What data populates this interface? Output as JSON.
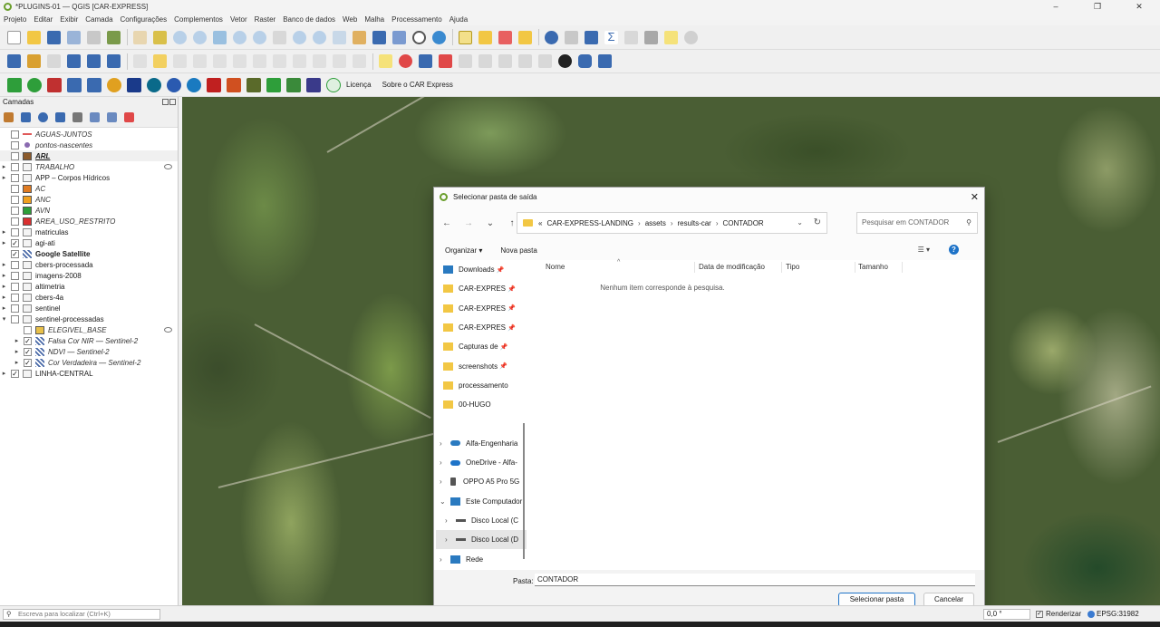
{
  "window": {
    "title": "*PLUGINS-01 — QGIS [CAR-EXPRESS]",
    "controls": [
      "–",
      "❐",
      "✕"
    ]
  },
  "menu": [
    "Projeto",
    "Editar",
    "Exibir",
    "Camada",
    "Configurações",
    "Complementos",
    "Vetor",
    "Raster",
    "Banco de dados",
    "Web",
    "Malha",
    "Processamento",
    "Ajuda"
  ],
  "plugin_toolbar": {
    "licenca_label": "Licença",
    "sobre_label": "Sobre o CAR Express"
  },
  "layers_panel": {
    "title": "Camadas",
    "layers": [
      {
        "label": "AGUAS-JUNTOS",
        "style": "it",
        "checked": false,
        "expander": "",
        "symbol_color": "#e05a5a",
        "symbol": "line"
      },
      {
        "label": "pontos-nascentes",
        "style": "it",
        "checked": false,
        "expander": "",
        "symbol_color": "#8a6ab0",
        "symbol": "dot"
      },
      {
        "label": "ARL",
        "style": "u",
        "checked": false,
        "expander": "",
        "symbol_color": "#8b5a2b",
        "symbol": "fill",
        "selected": true
      },
      {
        "label": "TRABALHO",
        "style": "it",
        "checked": false,
        "expander": "▸",
        "symbol_color": "#888888",
        "symbol": "group",
        "eye": true
      },
      {
        "label": "APP – Corpos Hídricos",
        "style": "",
        "checked": false,
        "expander": "▸",
        "symbol_color": "#888888",
        "symbol": "group"
      },
      {
        "label": "AC",
        "style": "it",
        "checked": false,
        "expander": "",
        "symbol_color": "#e07b22",
        "symbol": "fill"
      },
      {
        "label": "ANC",
        "style": "it",
        "checked": false,
        "expander": "",
        "symbol_color": "#f0a020",
        "symbol": "fill"
      },
      {
        "label": "AVN",
        "style": "it",
        "checked": false,
        "expander": "",
        "symbol_color": "#2e9e3a",
        "symbol": "fill"
      },
      {
        "label": "AREA_USO_RESTRITO",
        "style": "it",
        "checked": false,
        "expander": "",
        "symbol_color": "#d93030",
        "symbol": "fill"
      },
      {
        "label": "matriculas",
        "style": "",
        "checked": false,
        "expander": "▸",
        "symbol_color": "#888888",
        "symbol": "group"
      },
      {
        "label": "agi-ati",
        "style": "",
        "checked": true,
        "expander": "▸",
        "symbol_color": "#888888",
        "symbol": "group"
      },
      {
        "label": "Google Satellite",
        "style": "b",
        "checked": true,
        "expander": "",
        "symbol_color": "#4a6aa8",
        "symbol": "raster"
      },
      {
        "label": "cbers-processada",
        "style": "",
        "checked": false,
        "expander": "▸",
        "symbol_color": "#888888",
        "symbol": "group"
      },
      {
        "label": "imagens-2008",
        "style": "",
        "checked": false,
        "expander": "▸",
        "symbol_color": "#888888",
        "symbol": "group"
      },
      {
        "label": "altimetria",
        "style": "",
        "checked": false,
        "expander": "▸",
        "symbol_color": "#888888",
        "symbol": "group"
      },
      {
        "label": "cbers-4a",
        "style": "",
        "checked": false,
        "expander": "▸",
        "symbol_color": "#888888",
        "symbol": "group"
      },
      {
        "label": "sentinel",
        "style": "",
        "checked": false,
        "expander": "▸",
        "symbol_color": "#888888",
        "symbol": "group"
      },
      {
        "label": "sentinel-processadas",
        "style": "",
        "checked": false,
        "expander": "▾",
        "symbol_color": "#888888",
        "symbol": "group"
      },
      {
        "label": "ELEGIVEL_BASE",
        "style": "it",
        "checked": false,
        "expander": "",
        "symbol_color": "#e8c04a",
        "symbol": "fill",
        "indent": true,
        "eye": true
      },
      {
        "label": "Falsa Cor NIR — Sentinel-2",
        "style": "it",
        "checked": true,
        "expander": "▸",
        "symbol_color": "#4a6aa8",
        "symbol": "raster",
        "indent": true
      },
      {
        "label": "NDVI — Sentinel-2",
        "style": "it",
        "checked": true,
        "expander": "▸",
        "symbol_color": "#4a6aa8",
        "symbol": "raster",
        "indent": true
      },
      {
        "label": "Cor Verdadeira — Sentinel-2",
        "style": "it",
        "checked": true,
        "expander": "▸",
        "symbol_color": "#4a6aa8",
        "symbol": "raster",
        "indent": true
      },
      {
        "label": "LINHA-CENTRAL",
        "style": "",
        "checked": true,
        "expander": "▸",
        "symbol_color": "#888888",
        "symbol": "group"
      }
    ]
  },
  "dialog": {
    "title": "Selecionar pasta de saída",
    "breadcrumb": [
      "«",
      "CAR-EXPRESS-LANDING",
      "assets",
      "results-car",
      "CONTADOR"
    ],
    "search_placeholder": "Pesquisar em CONTADOR",
    "organize_label": "Organizar ▾",
    "new_folder_label": "Nova pasta",
    "columns": [
      "Nome",
      "Data de modificação",
      "Tipo",
      "Tamanho"
    ],
    "empty_message": "Nenhum item corresponde à pesquisa.",
    "nav_items": [
      {
        "label": "Downloads",
        "icon": "download",
        "pin": true,
        "chev": ""
      },
      {
        "label": "CAR-EXPRES",
        "icon": "folder",
        "pin": true,
        "chev": ""
      },
      {
        "label": "CAR-EXPRES",
        "icon": "folder",
        "pin": true,
        "chev": ""
      },
      {
        "label": "CAR-EXPRES",
        "icon": "folder",
        "pin": true,
        "chev": ""
      },
      {
        "label": "Capturas de",
        "icon": "folder",
        "pin": true,
        "chev": ""
      },
      {
        "label": "screenshots",
        "icon": "folder",
        "pin": true,
        "chev": ""
      },
      {
        "label": "processamento",
        "icon": "folder",
        "pin": false,
        "chev": ""
      },
      {
        "label": "00-HUGO",
        "icon": "folder",
        "pin": false,
        "chev": ""
      },
      {
        "label": "",
        "icon": "",
        "pin": false,
        "chev": ""
      },
      {
        "label": "Alfa-Engenharia",
        "icon": "cloud",
        "pin": false,
        "chev": "›"
      },
      {
        "label": "OneDrive - Alfa-",
        "icon": "onedrive",
        "pin": false,
        "chev": "›"
      },
      {
        "label": "OPPO A5 Pro 5G",
        "icon": "phone",
        "pin": false,
        "chev": "›"
      },
      {
        "label": "Este Computador",
        "icon": "pc",
        "pin": false,
        "chev": "⌄"
      },
      {
        "label": "Disco Local (C",
        "icon": "disk",
        "pin": false,
        "chev": "›",
        "sub": true
      },
      {
        "label": "Disco Local (D",
        "icon": "disk",
        "pin": false,
        "chev": "›",
        "sub": true,
        "selected": true
      },
      {
        "label": "Rede",
        "icon": "network",
        "pin": false,
        "chev": "›"
      }
    ],
    "folder_label": "Pasta:",
    "folder_value": "CONTADOR",
    "select_button": "Selecionar pasta",
    "cancel_button": "Cancelar"
  },
  "statusbar": {
    "locator_placeholder": "Escreva para localizar (Ctrl+K)",
    "rotation_value": "0,0 °",
    "render_label": "Renderizar",
    "render_checked": true,
    "crs_label": "EPSG:31982"
  }
}
